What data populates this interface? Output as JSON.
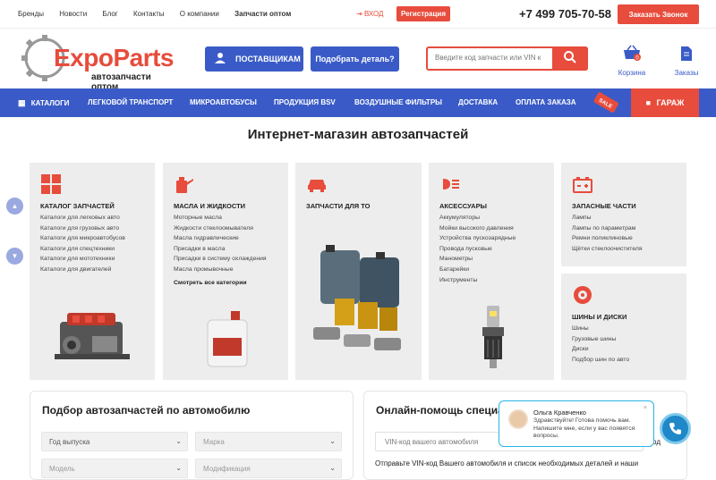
{
  "topbar": {
    "links": [
      "Бренды",
      "Новости",
      "Блог",
      "Контакты",
      "О компании",
      "Запчасти оптом"
    ],
    "login": "ВХОД",
    "register": "Регистрация",
    "phone": "+7 499 705-70-58",
    "call_btn": "Заказать Звонок"
  },
  "header": {
    "logo": "ExpoParts",
    "logo_sub": "автозапчасти оптом",
    "suppliers_btn": "ПОСТАВЩИКАМ",
    "pick_btn": "Подобрать деталь?",
    "search_placeholder": "Введите код запчасти или VIN к",
    "cart": "Корзина",
    "cart_count": "0",
    "orders": "Заказы"
  },
  "nav": {
    "items": [
      "КАТАЛОГИ",
      "ЛЕГКОВОЙ ТРАНСПОРТ",
      "МИКРОАВТОБУСЫ",
      "ПРОДУКЦИЯ BSV",
      "ВОЗДУШНЫЕ ФИЛЬТРЫ",
      "ДОСТАВКА",
      "ОПЛАТА ЗАКАЗА"
    ],
    "sale_tag": "SALE",
    "garage": "ГАРАЖ"
  },
  "main_title": "Интернет-магазин автозапчастей",
  "cards": {
    "catalog": {
      "title": "КАТАЛОГ ЗАПЧАСТЕЙ",
      "items": [
        "Каталоги для легковых авто",
        "Каталоги для грузовых авто",
        "Каталоги для микроавтобусов",
        "Каталоги для спецтехники",
        "Каталоги для мототехники",
        "Каталоги для двигателей"
      ]
    },
    "oils": {
      "title": "МАСЛА И ЖИДКОСТИ",
      "items": [
        "Моторные масла",
        "Жидкости стеклоомывателя",
        "Масла гидравлические",
        "Присадки в масла",
        "Присадки в систему охлаждения",
        "Масла промывочные"
      ],
      "more": "Смотреть все категории"
    },
    "to": {
      "title": "ЗАПЧАСТИ ДЛЯ ТО"
    },
    "accessories": {
      "title": "АКСЕССУАРЫ",
      "items": [
        "Аккумуляторы",
        "Мойки высокого давления",
        "Устройства пускозарядные",
        "Провода пусковые",
        "Манометры",
        "Батарейки",
        "Инструменты"
      ]
    },
    "spare": {
      "title": "ЗАПАСНЫЕ ЧАСТИ",
      "items": [
        "Лампы",
        "Лампы по параметрам",
        "Ремни поликлиновые",
        "Щётки стеклоочистителя"
      ]
    },
    "tires": {
      "title": "ШИНЫ И ДИСКИ",
      "items": [
        "Шины",
        "Грузовые шины",
        "Диски",
        "Подбор шин по авто"
      ]
    }
  },
  "selection": {
    "title": "Подбор автозапчастей по автомобилю",
    "year": "Год выпуска",
    "brand": "Марка",
    "model": "Модель",
    "modification": "Модификация"
  },
  "online": {
    "title": "Онлайн-помощь специал",
    "vin_placeholder": "VIN-код вашего автомобиля",
    "vin_suffix": "од",
    "text": "Отправьте VIN-код Вашего автомобиля и список необходимых деталей и наши"
  },
  "chat": {
    "name": "Ольга Кравченко",
    "message": "Здравствуйте! Готова помочь вам. Напишите мне, если у вас появятся вопросы.",
    "close": "×"
  },
  "colors": {
    "accent_red": "#e74c3c",
    "accent_blue": "#3a5bc7"
  }
}
